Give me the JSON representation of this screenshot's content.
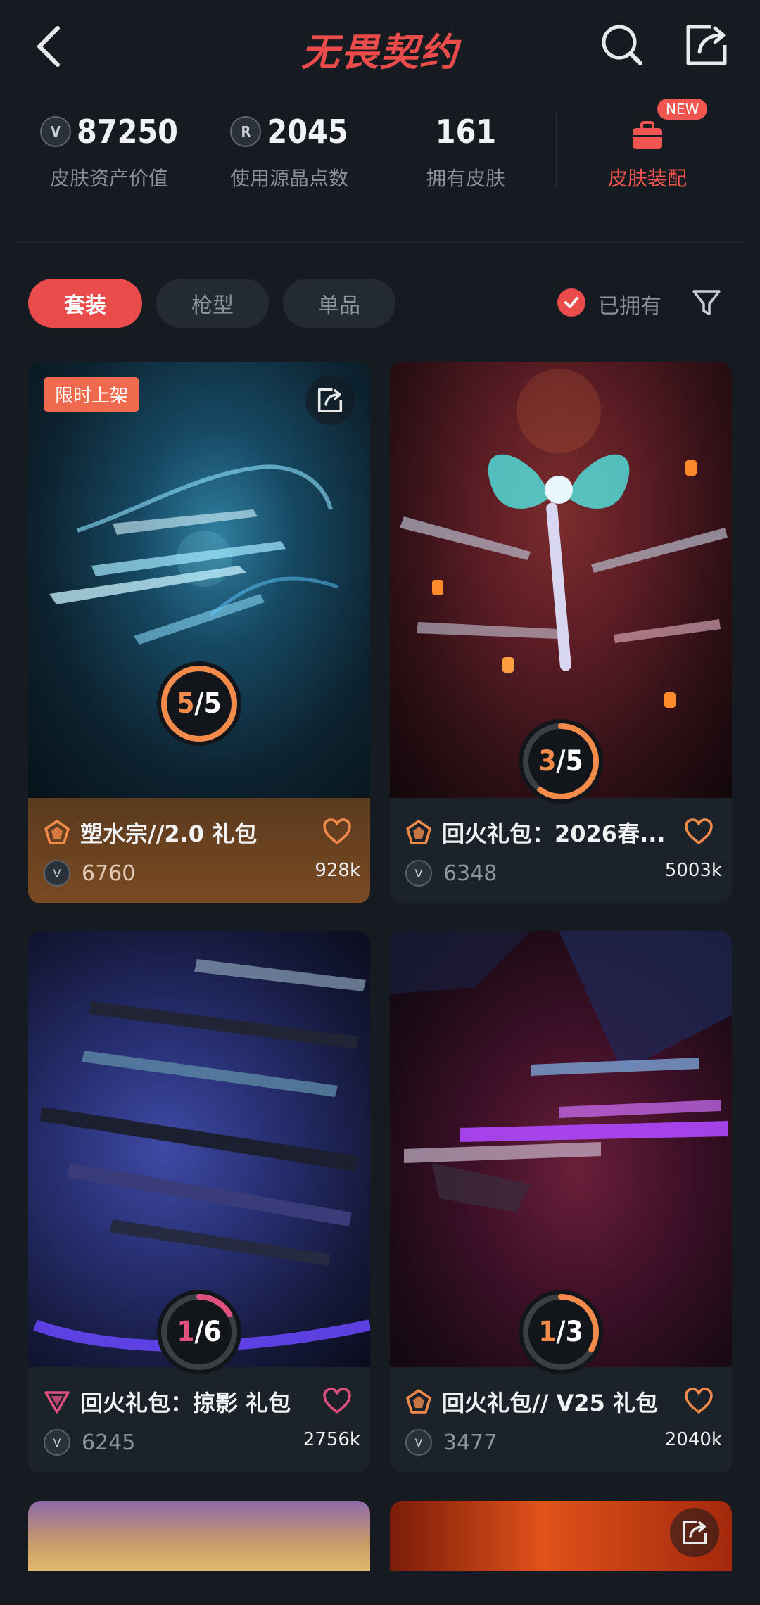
{
  "header": {
    "logo_text": "无畏契约"
  },
  "stats": [
    {
      "value": "87250",
      "label": "皮肤资产价值",
      "icon": "vp-coin-icon"
    },
    {
      "value": "2045",
      "label": "使用源晶点数",
      "icon": "radianite-coin-icon"
    },
    {
      "value": "161",
      "label": "拥有皮肤"
    }
  ],
  "equip": {
    "label": "皮肤装配",
    "badge": "NEW"
  },
  "tabs": [
    {
      "label": "套装",
      "active": true
    },
    {
      "label": "枪型",
      "active": false
    },
    {
      "label": "单品",
      "active": false
    }
  ],
  "owned_filter": {
    "label": "已拥有",
    "checked": true
  },
  "colors": {
    "accent": "#ea4b4b",
    "bg": "#161b21",
    "card_bg": "#1c2229",
    "orange": "#f28a4a",
    "pink": "#e0507f"
  },
  "cards": [
    {
      "title": "塑水宗//2.0 礼包",
      "price": "6760",
      "likes": "928k",
      "owned": "5",
      "total": "5",
      "progress": 1.0,
      "limited": "限时上架",
      "tier": "orange",
      "footer": "orange"
    },
    {
      "title": "回火礼包：2026春...",
      "price": "6348",
      "likes": "5003k",
      "owned": "3",
      "total": "5",
      "progress": 0.6,
      "tier": "orange",
      "footer": "dark"
    },
    {
      "title": "回火礼包：掠影 礼包",
      "price": "6245",
      "likes": "2756k",
      "owned": "1",
      "total": "6",
      "progress": 0.1667,
      "tier": "pink",
      "footer": "dark"
    },
    {
      "title": "回火礼包// V25 礼包",
      "price": "3477",
      "likes": "2040k",
      "owned": "1",
      "total": "3",
      "progress": 0.3333,
      "tier": "orange",
      "footer": "dark"
    }
  ]
}
